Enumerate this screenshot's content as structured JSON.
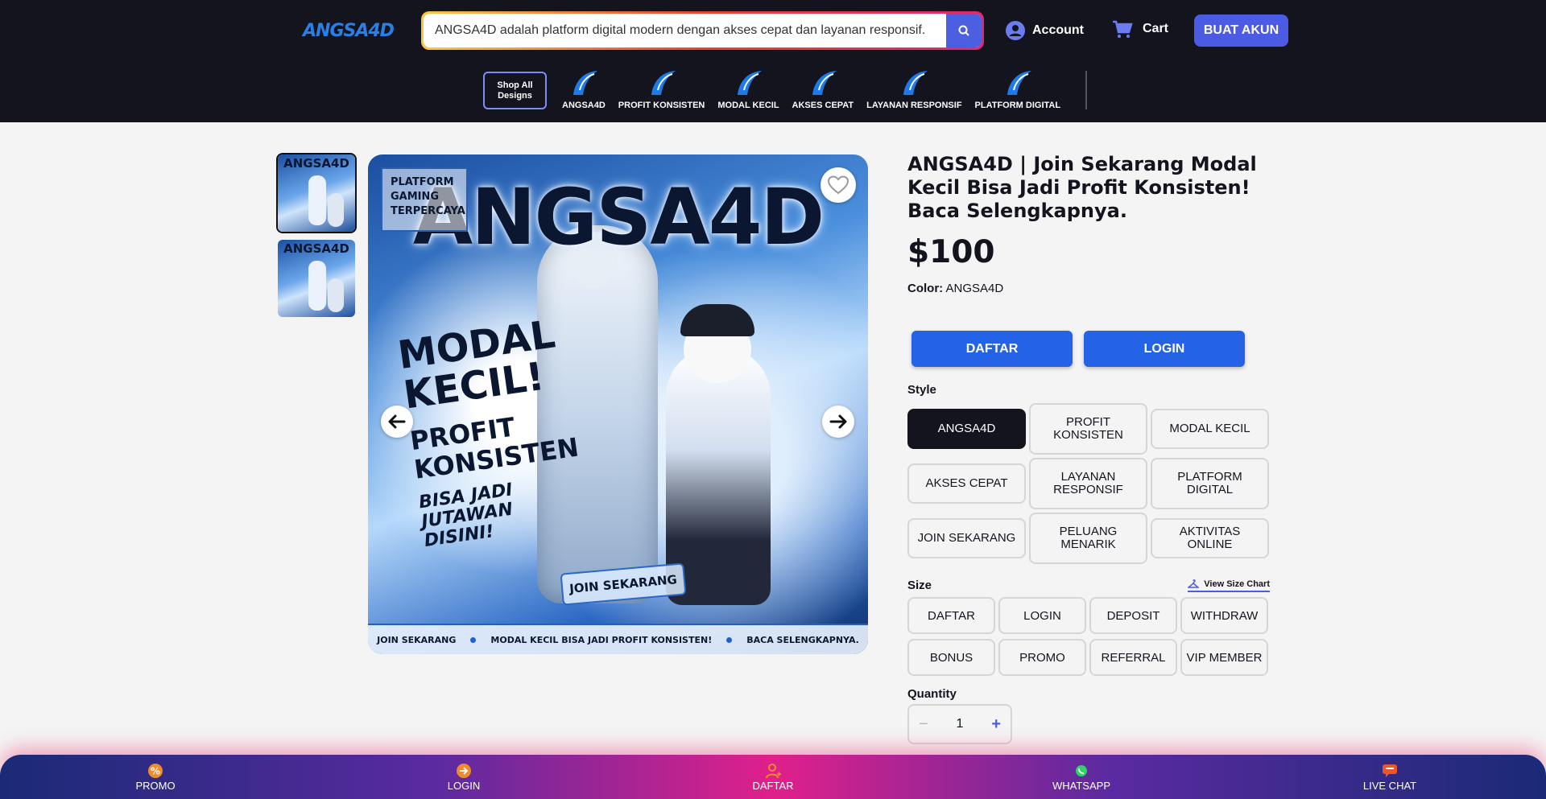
{
  "brand": {
    "logo_text": "ANGSA4D"
  },
  "search": {
    "value": "ANGSA4D adalah platform digital modern dengan akses cepat dan layanan responsif."
  },
  "header": {
    "account_label": "Account",
    "cart_label": "Cart",
    "cta_label": "BUAT AKUN"
  },
  "categories": {
    "shop_all": "Shop All Designs",
    "items": [
      {
        "label": "ANGSA4D"
      },
      {
        "label": "PROFIT KONSISTEN"
      },
      {
        "label": "MODAL KECIL"
      },
      {
        "label": "AKSES CEPAT"
      },
      {
        "label": "LAYANAN RESPONSIF"
      },
      {
        "label": "PLATFORM DIGITAL"
      }
    ]
  },
  "product": {
    "title": "ANGSA4D | Join Sekarang Modal Kecil Bisa Jadi Profit Konsisten! Baca Selengkapnya.",
    "price": "$100",
    "color_label": "Color:",
    "color_value": "ANGSA4D",
    "primary_buttons": [
      "DAFTAR",
      "LOGIN"
    ],
    "style_label": "Style",
    "styles": [
      {
        "label": "ANGSA4D",
        "selected": true
      },
      {
        "label": "PROFIT KONSISTEN",
        "selected": false
      },
      {
        "label": "MODAL KECIL",
        "selected": false
      },
      {
        "label": "AKSES CEPAT",
        "selected": false
      },
      {
        "label": "LAYANAN RESPONSIF",
        "selected": false
      },
      {
        "label": "PLATFORM DIGITAL",
        "selected": false
      },
      {
        "label": "JOIN SEKARANG",
        "selected": false
      },
      {
        "label": "PELUANG MENARIK",
        "selected": false
      },
      {
        "label": "AKTIVITAS ONLINE",
        "selected": false
      }
    ],
    "size_label": "Size",
    "size_chart_label": "View Size Chart",
    "sizes": [
      "DAFTAR",
      "LOGIN",
      "DEPOSIT",
      "WITHDRAW",
      "BONUS",
      "PROMO",
      "REFERRAL",
      "VIP MEMBER"
    ],
    "quantity_label": "Quantity",
    "quantity_value": "1",
    "quantity_minus": "−",
    "quantity_plus": "+"
  },
  "gallery": {
    "thumb_count": 2,
    "art": {
      "title": "ANGSA4D",
      "badge": "PLATFORM GAMING TERPERCAYA",
      "modal_line1": "MODAL",
      "modal_line2": "KECIL!",
      "profit_line1": "PROFIT",
      "profit_line2": "KONSISTEN",
      "tagline1": "BISA JADI",
      "tagline2": "JUTAWAN",
      "tagline3": "DISINI!",
      "cta": "JOIN SEKARANG",
      "footer": [
        "JOIN SEKARANG",
        "MODAL KECIL BISA JADI PROFIT KONSISTEN!",
        "BACA SELENGKAPNYA."
      ]
    }
  },
  "bottom_nav": [
    {
      "label": "PROMO",
      "icon": "percent-badge-icon"
    },
    {
      "label": "LOGIN",
      "icon": "login-arrow-icon"
    },
    {
      "label": "DAFTAR",
      "icon": "user-add-icon"
    },
    {
      "label": "WHATSAPP",
      "icon": "whatsapp-icon"
    },
    {
      "label": "LIVE CHAT",
      "icon": "chat-bubble-icon"
    }
  ],
  "colors": {
    "header_bg": "#14141f",
    "accent": "#4b5be3",
    "action_blue": "#2563e6",
    "bottom_pink": "#e0208a"
  }
}
